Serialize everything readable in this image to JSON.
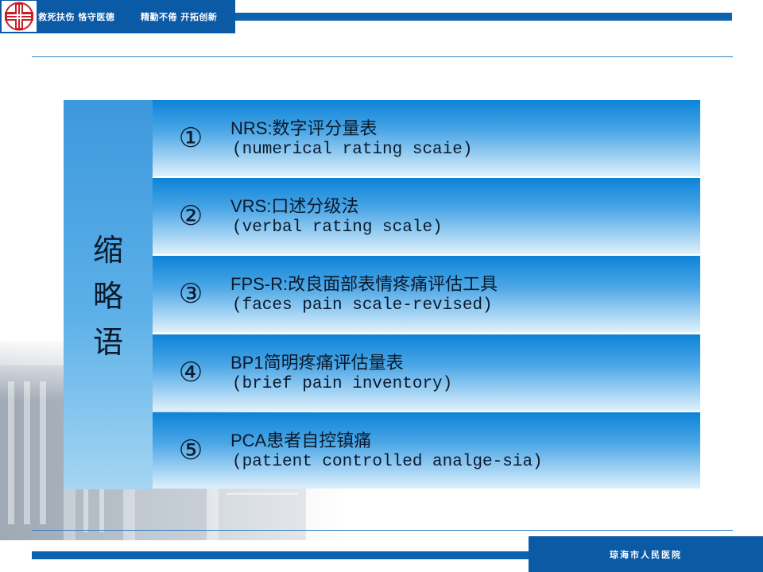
{
  "header": {
    "slogan_1": "救死扶伤 恪守医德",
    "slogan_2": "精勤不倦 开拓创新",
    "logo_icon": "hospital-cross-logo-icon"
  },
  "side_label": {
    "chars": [
      "缩",
      "略",
      "语"
    ]
  },
  "rows": [
    {
      "num": "①",
      "title": "NRS:数字评分量表",
      "subtitle": "(numerical rating scaie)"
    },
    {
      "num": "②",
      "title": "VRS:口述分级法",
      "subtitle": "(verbal rating scale)"
    },
    {
      "num": "③",
      "title": "FPS-R:改良面部表情疼痛评估工具",
      "subtitle": "(faces pain scale-revised)"
    },
    {
      "num": "④",
      "title": "BP1简明疼痛评估量表",
      "subtitle": "(brief pain inventory)"
    },
    {
      "num": "⑤",
      "title": "PCA患者自控镇痛",
      "subtitle": "(patient controlled analge-sia)"
    }
  ],
  "footer": {
    "org_name": "琼海市人民医院"
  },
  "colors": {
    "brand_blue": "#0b5aa6",
    "row_top": "#0c83d8",
    "row_bottom": "#dff1fc",
    "logo_red": "#c8202a"
  }
}
